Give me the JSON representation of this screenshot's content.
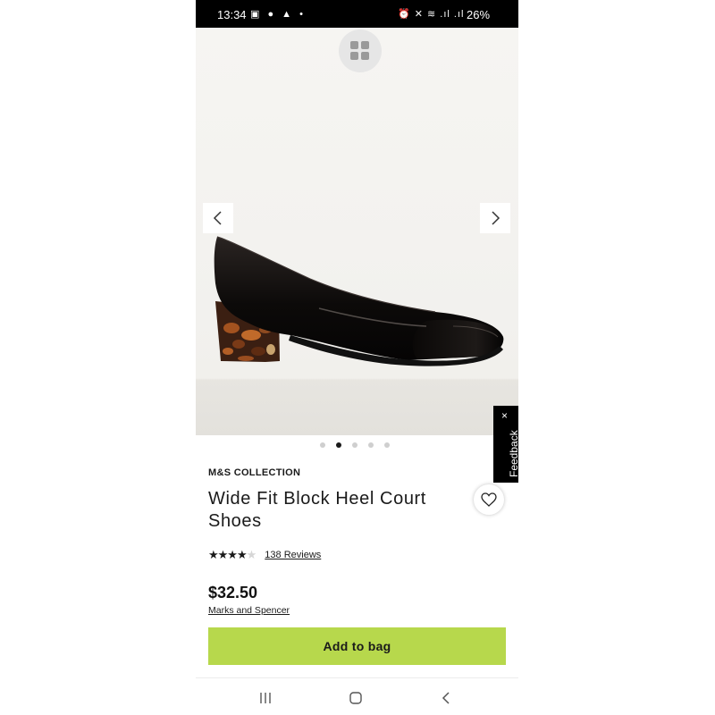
{
  "status_bar": {
    "time": "13:34",
    "left_icons": "▣ ● ▲ •",
    "right_icons": "⏰ ✕ ≋ .ıl .ıl",
    "battery": "26%"
  },
  "gallery": {
    "current_image": 2,
    "total_images": 5
  },
  "feedback": {
    "label": "Feedback",
    "close": "×"
  },
  "product": {
    "brand": "M&S COLLECTION",
    "title": "Wide Fit Block Heel Court Shoes",
    "rating": 4.5,
    "reviews": "138 Reviews",
    "price": "$32.50",
    "seller": "Marks and Spencer",
    "add_to_bag": "Add to bag"
  },
  "colors": {
    "accent": "#b7d84c",
    "status_bar": "#000000"
  }
}
